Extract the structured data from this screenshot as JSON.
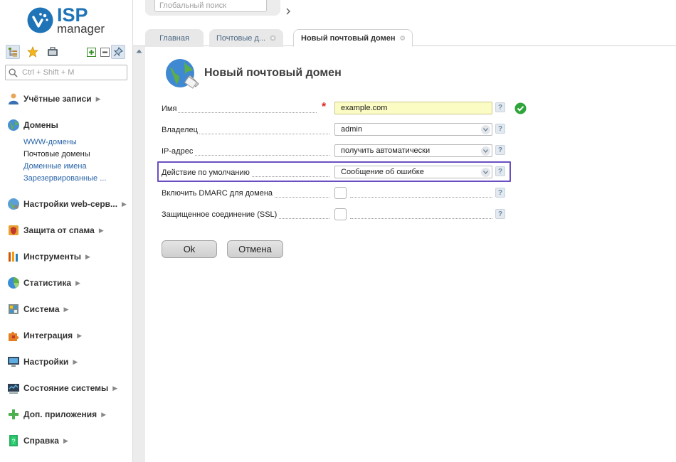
{
  "app": {
    "brand_primary": "ISP",
    "brand_secondary": "manager",
    "accent_color": "#1f73b7"
  },
  "sidebar": {
    "search_placeholder": "Ctrl + Shift + M",
    "toolbar_icons": [
      "tree-icon",
      "star-icon",
      "briefcase-icon",
      "expand-all-icon",
      "collapse-all-icon",
      "pin-icon"
    ],
    "sections": [
      {
        "label": "Учётные записи",
        "icon": "users-icon"
      },
      {
        "label": "Домены",
        "icon": "globe-icon",
        "children": [
          "WWW-домены",
          "Почтовые домены",
          "Доменные имена",
          "Зарезервированные ..."
        ],
        "current_child": 1
      },
      {
        "label": "Настройки web-серв...",
        "icon": "web-settings-icon"
      },
      {
        "label": "Защита от спама",
        "icon": "shield-icon"
      },
      {
        "label": "Инструменты",
        "icon": "tools-icon"
      },
      {
        "label": "Статистика",
        "icon": "pie-chart-icon"
      },
      {
        "label": "Система",
        "icon": "system-icon"
      },
      {
        "label": "Интеграция",
        "icon": "puzzle-icon"
      },
      {
        "label": "Настройки",
        "icon": "monitor-icon"
      },
      {
        "label": "Состояние системы",
        "icon": "status-icon"
      },
      {
        "label": "Доп. приложения",
        "icon": "plus-icon"
      },
      {
        "label": "Справка",
        "icon": "help-book-icon"
      }
    ]
  },
  "header": {
    "global_search_placeholder": "Глобальный поиск"
  },
  "tabs": [
    {
      "label": "Главная",
      "closable": false
    },
    {
      "label": "Почтовые д...",
      "closable": true
    },
    {
      "label": "Новый почтовый домен",
      "closable": true,
      "active": true
    }
  ],
  "form": {
    "title": "Новый почтовый домен",
    "fields": [
      {
        "label": "Имя",
        "value": "example.com",
        "required": true,
        "valid": true
      },
      {
        "label": "Владелец",
        "value": "admin"
      },
      {
        "label": "IP-адрес",
        "value": "получить автоматически"
      },
      {
        "label": "Действие по умолчанию",
        "value": "Сообщение об ошибке",
        "highlighted": true
      },
      {
        "label": "Включить DMARC для домена",
        "checked": false
      },
      {
        "label": "Защищенное соединение (SSL)",
        "checked": false
      }
    ],
    "help_label": "?",
    "required_mark": "*",
    "ok_label": "Ok",
    "cancel_label": "Отмена"
  }
}
